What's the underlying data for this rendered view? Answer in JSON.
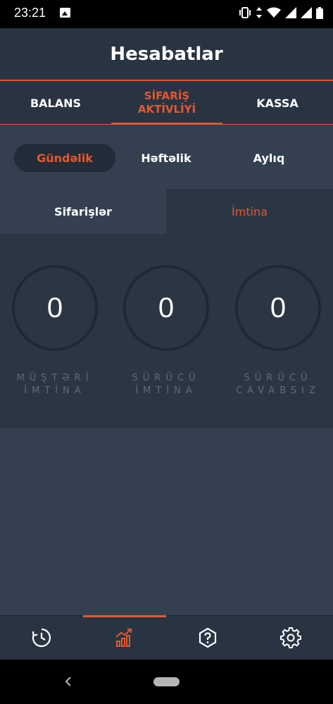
{
  "status_bar": {
    "time": "23:21"
  },
  "header": {
    "title": "Hesabatlar"
  },
  "tabs": [
    {
      "label": "BALANS",
      "active": false
    },
    {
      "label": "SİFARİŞ\nAKTİVLİYİ",
      "active": true
    },
    {
      "label": "KASSA",
      "active": false
    }
  ],
  "periods": [
    {
      "label": "Gündəlik",
      "active": true
    },
    {
      "label": "Həftəlik",
      "active": false
    },
    {
      "label": "Aylıq",
      "active": false
    }
  ],
  "subtabs": [
    {
      "label": "Sifarişlər",
      "active": false
    },
    {
      "label": "İmtina",
      "active": true
    }
  ],
  "stats": [
    {
      "value": "0",
      "label": "MÜŞTƏRİ\nİMTİNA"
    },
    {
      "value": "0",
      "label": "SÜRÜCÜ\nİMTİNA"
    },
    {
      "value": "0",
      "label": "SÜRÜCÜ\nCAVABSIZ"
    }
  ],
  "bottom_nav": [
    {
      "icon": "history-icon",
      "active": false
    },
    {
      "icon": "chart-icon",
      "active": true
    },
    {
      "icon": "help-icon",
      "active": false
    },
    {
      "icon": "settings-icon",
      "active": false
    }
  ],
  "colors": {
    "accent": "#e4572e",
    "background": "#34404f",
    "header": "#293442",
    "panel": "#2b3645"
  }
}
